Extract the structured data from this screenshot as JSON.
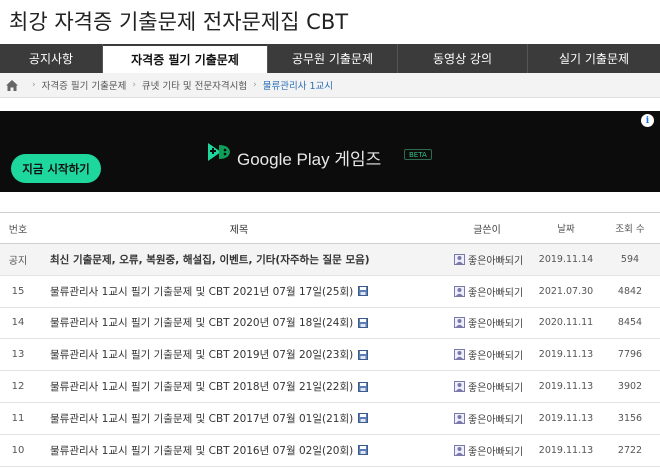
{
  "site": {
    "title": "최강 자격증 기출문제 전자문제집 CBT"
  },
  "nav": {
    "items": [
      {
        "label": "공지사항",
        "active": false
      },
      {
        "label": "자격증 필기 기출문제",
        "active": true
      },
      {
        "label": "공무원 기출문제",
        "active": false
      },
      {
        "label": "동영상 강의",
        "active": false
      },
      {
        "label": "실기 기출문제",
        "active": false
      }
    ]
  },
  "breadcrumb": {
    "items": [
      "자격증 필기 기출문제",
      "큐넷 기타 및 전문자격시험",
      "물류관리사 1교시"
    ]
  },
  "ad": {
    "cta": "지금 시작하기",
    "brand": "Google Play 게임즈",
    "badge": "BETA",
    "info": "i"
  },
  "board": {
    "headers": {
      "no": "번호",
      "title": "제목",
      "writer": "글쓴이",
      "date": "날짜",
      "views": "조회 수"
    },
    "notice": {
      "no": "공지",
      "title": "최신 기출문제, 오류, 복원중, 해설집, 이벤트, 기타(자주하는 질문 모음)",
      "writer": "좋은아빠되기",
      "date": "2019.11.14",
      "views": "594"
    },
    "rows": [
      {
        "no": "15",
        "title": "물류관리사 1교시 필기 기출문제 및 CBT 2021년 07월 17일(25회)",
        "writer": "좋은아빠되기",
        "date": "2021.07.30",
        "views": "4842"
      },
      {
        "no": "14",
        "title": "물류관리사 1교시 필기 기출문제 및 CBT 2020년 07월 18일(24회)",
        "writer": "좋은아빠되기",
        "date": "2020.11.11",
        "views": "8454"
      },
      {
        "no": "13",
        "title": "물류관리사 1교시 필기 기출문제 및 CBT 2019년 07월 20일(23회)",
        "writer": "좋은아빠되기",
        "date": "2019.11.13",
        "views": "7796"
      },
      {
        "no": "12",
        "title": "물류관리사 1교시 필기 기출문제 및 CBT 2018년 07월 21일(22회)",
        "writer": "좋은아빠되기",
        "date": "2019.11.13",
        "views": "3902"
      },
      {
        "no": "11",
        "title": "물류관리사 1교시 필기 기출문제 및 CBT 2017년 07월 01일(21회)",
        "writer": "좋은아빠되기",
        "date": "2019.11.13",
        "views": "3156"
      },
      {
        "no": "10",
        "title": "물류관리사 1교시 필기 기출문제 및 CBT 2016년 07월 02일(20회)",
        "writer": "좋은아빠되기",
        "date": "2019.11.13",
        "views": "2722"
      }
    ]
  },
  "colors": {
    "nav_bg": "#3b3b3b",
    "accent_link": "#2a6fb6",
    "ad_cta": "#1ed79c"
  }
}
